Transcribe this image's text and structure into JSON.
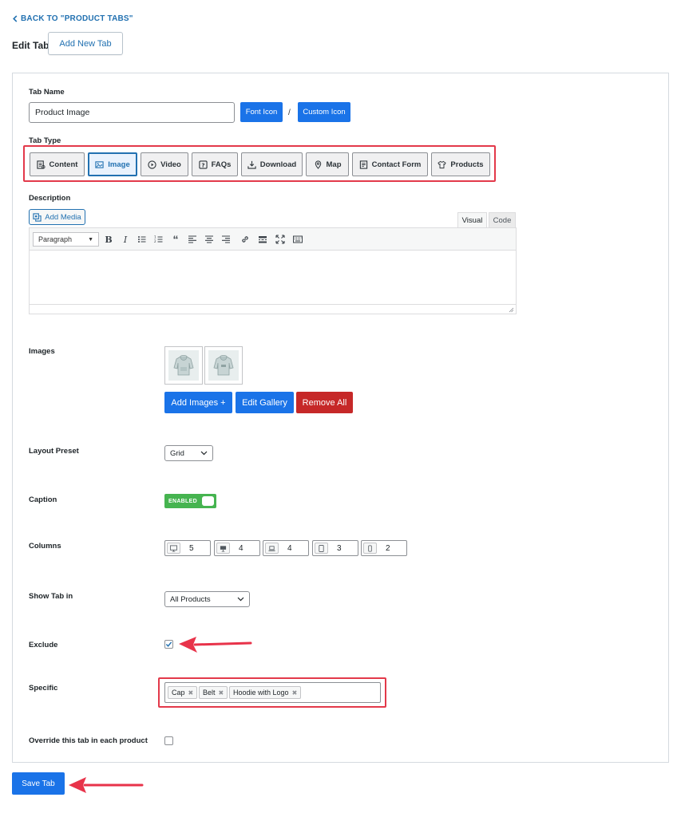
{
  "header": {
    "back_link": "BACK TO \"PRODUCT TABS\"",
    "title": "Edit Tab",
    "add_new_label": "Add New Tab"
  },
  "tab_name": {
    "label": "Tab Name",
    "value": "Product Image",
    "font_icon_label": "Font Icon",
    "separator": "/",
    "custom_icon_label": "Custom Icon"
  },
  "tab_type": {
    "label": "Tab Type",
    "selected": "Image",
    "options": [
      {
        "label": "Content",
        "icon": "content-icon"
      },
      {
        "label": "Image",
        "icon": "image-icon"
      },
      {
        "label": "Video",
        "icon": "play-icon"
      },
      {
        "label": "FAQs",
        "icon": "faq-icon"
      },
      {
        "label": "Download",
        "icon": "download-icon"
      },
      {
        "label": "Map",
        "icon": "map-pin-icon"
      },
      {
        "label": "Contact Form",
        "icon": "form-icon"
      },
      {
        "label": "Products",
        "icon": "tshirt-icon"
      }
    ]
  },
  "description": {
    "label": "Description",
    "add_media_label": "Add Media",
    "visual_tab": "Visual",
    "code_tab": "Code",
    "format_value": "Paragraph"
  },
  "images": {
    "label": "Images",
    "add_label": "Add Images +",
    "edit_label": "Edit Gallery",
    "remove_label": "Remove All"
  },
  "layout": {
    "label": "Layout Preset",
    "value": "Grid"
  },
  "caption": {
    "label": "Caption",
    "state_text": "ENABLED"
  },
  "columns": {
    "label": "Columns",
    "values": [
      "5",
      "4",
      "4",
      "3",
      "2"
    ]
  },
  "show_in": {
    "label": "Show Tab in",
    "value": "All Products"
  },
  "exclude": {
    "label": "Exclude",
    "checked": true
  },
  "specific": {
    "label": "Specific",
    "chips": [
      "Cap",
      "Belt",
      "Hoodie with Logo"
    ],
    "remove_glyph": "✖"
  },
  "override": {
    "label": "Override this tab in each product",
    "checked": false
  },
  "footer": {
    "save_label": "Save Tab"
  },
  "colors": {
    "primary": "#1a73e8",
    "danger": "#c62828",
    "success": "#46b450",
    "highlight": "#e3394a"
  }
}
